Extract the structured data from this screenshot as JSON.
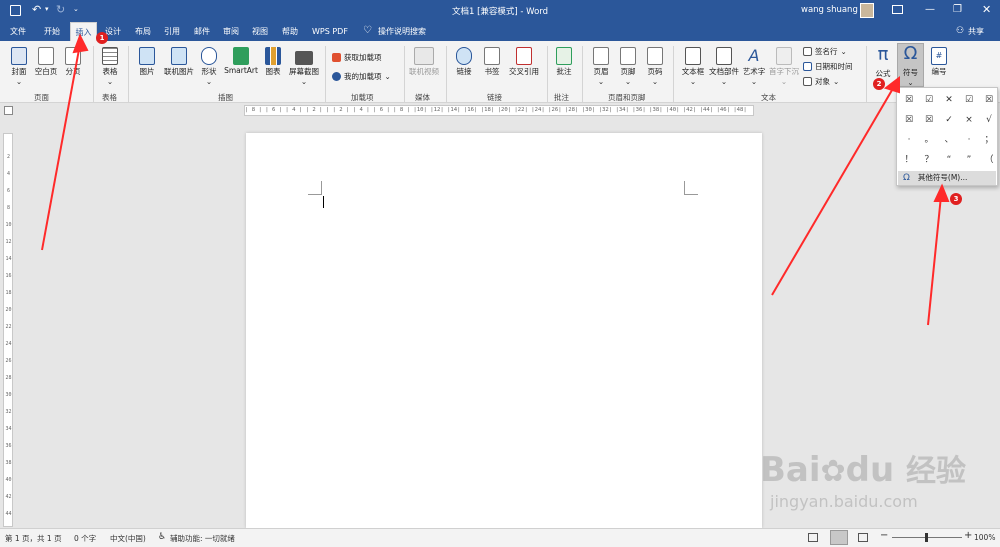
{
  "title_bar": {
    "title": "文档1 [兼容模式] - Word",
    "user": "wang shuang",
    "window_controls": [
      "minimize-icon",
      "restore-icon",
      "close-icon"
    ]
  },
  "quick_access": [
    "save-icon",
    "undo-icon",
    "redo-icon",
    "customize-icon"
  ],
  "tabs": [
    {
      "label": "文件",
      "name": "tab-file"
    },
    {
      "label": "开始",
      "name": "tab-home"
    },
    {
      "label": "插入",
      "name": "tab-insert",
      "active": true
    },
    {
      "label": "设计",
      "name": "tab-design"
    },
    {
      "label": "布局",
      "name": "tab-layout"
    },
    {
      "label": "引用",
      "name": "tab-references"
    },
    {
      "label": "邮件",
      "name": "tab-mailings"
    },
    {
      "label": "审阅",
      "name": "tab-review"
    },
    {
      "label": "视图",
      "name": "tab-view"
    },
    {
      "label": "帮助",
      "name": "tab-help"
    },
    {
      "label": "WPS PDF",
      "name": "tab-wps-pdf"
    }
  ],
  "tell_me": "操作说明搜索",
  "share": "共享",
  "ribbon": {
    "buttons": {
      "cover": "封面",
      "blank_page": "空白页",
      "page_break": "分页",
      "table": "表格",
      "picture": "图片",
      "online_picture": "联机图片",
      "shapes": "形状",
      "smartart": "SmartArt",
      "chart": "图表",
      "screenshot": "屏幕截图",
      "get_addins": "获取加载项",
      "my_addins": "我的加载项",
      "online_video": "联机视频",
      "link": "链接",
      "bookmark": "书签",
      "cross_reference": "交叉引用",
      "comment": "批注",
      "header": "页眉",
      "footer": "页脚",
      "page_number": "页码",
      "text_box": "文本框",
      "quick_parts": "文档部件",
      "wordart": "艺术字",
      "drop_cap": "首字下沉",
      "signature_line": "签名行",
      "date_time": "日期和时间",
      "object": "对象",
      "equation": "公式",
      "symbol": "符号",
      "numbering": "编号"
    },
    "groups": {
      "pages": "页面",
      "tables": "表格",
      "illustrations": "插图",
      "addins": "加载项",
      "media": "媒体",
      "links": "链接",
      "comments": "批注",
      "header_footer": "页眉和页脚",
      "text": "文本"
    }
  },
  "symbol_dropdown": {
    "symbols": [
      "☒",
      "☑",
      "✕",
      "☑",
      "☒",
      "☒",
      "☒",
      "✓",
      "×",
      "√",
      "·",
      "。",
      "、",
      "·",
      "；",
      "！",
      "？",
      "“",
      "”",
      "（"
    ],
    "more_symbols": "其他符号(M)..."
  },
  "ruler": {
    "horizontal": "| 8 |  | 6 |  | 4 |  | 2 |  |   | 2 |  | 4 |  | 6 |  | 8 |  |10|  |12|  |14|  |16|  |18|  |20|  |22|  |24|  |26|  |28|  |30|  |32|  |34|  |36|  |38|  |40|  |42|  |44|  |46|  |48|",
    "vertical": [
      "2",
      "4",
      "6",
      "8",
      "10",
      "12",
      "14",
      "16",
      "18",
      "20",
      "22",
      "24",
      "26",
      "28",
      "30",
      "32",
      "34",
      "36",
      "38",
      "40",
      "42",
      "44"
    ]
  },
  "status_bar": {
    "page": "第 1 页，共 1 页",
    "words": "0 个字",
    "language": "中文(中国)",
    "accessibility": "辅助功能: 一切就绪",
    "zoom": "100%"
  },
  "annotations": [
    "1",
    "2",
    "3"
  ],
  "watermark": {
    "brand": "Bai",
    "brand2": "du",
    "cn": "经验",
    "url": "jingyan.baidu.com"
  },
  "colors": {
    "titlebar": "#2b579a",
    "ribbon": "#f3f3f3",
    "annotation": "#e02020"
  }
}
